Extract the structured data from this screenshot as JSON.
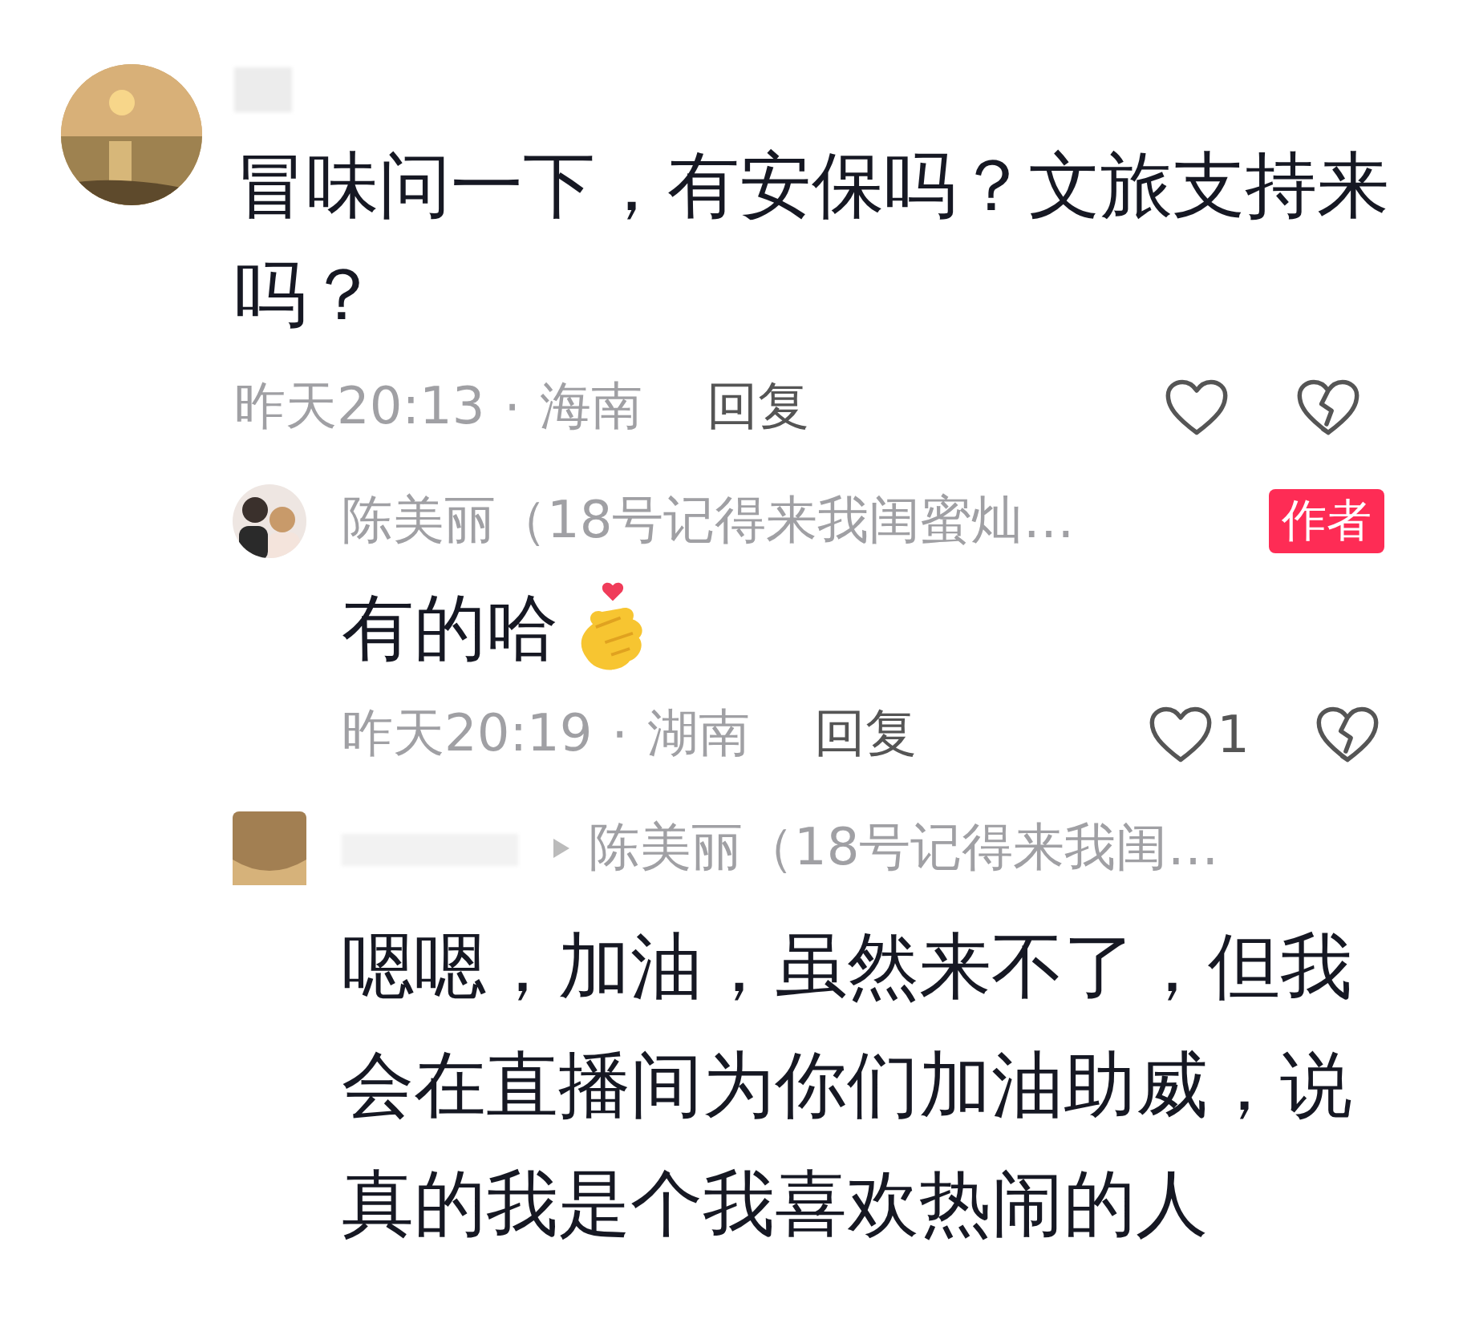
{
  "comment": {
    "author_redacted": true,
    "text": "冒味问一下，有安保吗？文旅支持来吗？",
    "time": "昨天20:13",
    "separator": "·",
    "location": "海南",
    "reply_button": "回复",
    "liked": false,
    "disliked": false
  },
  "replies": [
    {
      "kind": "author_reply",
      "author": "陈美丽（18号记得来我闺蜜灿…",
      "badge": "作者",
      "text": "有的哈",
      "sticker": {
        "kind": "finger_heart"
      },
      "time": "昨天20:19",
      "separator": "·",
      "location": "湖南",
      "reply_button": "回复",
      "liked": false,
      "like_count": "1",
      "disliked": false
    },
    {
      "kind": "nested_reply",
      "author_redacted": true,
      "reply_to": "陈美丽（18号记得来我闺…",
      "text": "嗯嗯，加油，虽然来不了，但我会在直播间为你们加油助威，说真的我是个我喜欢热闹的人"
    }
  ]
}
